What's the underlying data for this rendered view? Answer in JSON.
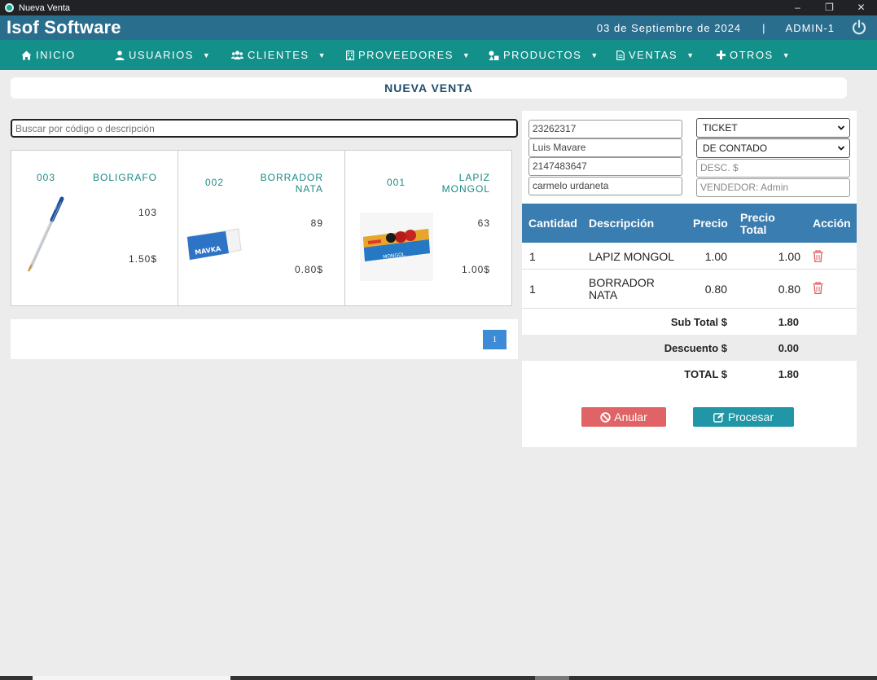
{
  "window": {
    "title": "Nueva Venta",
    "controls": [
      "–",
      "❐",
      "✕"
    ]
  },
  "header": {
    "brand": "Isof Software",
    "date": "03 de Septiembre de 2024",
    "separator": "|",
    "user": "ADMIN-1"
  },
  "nav": [
    {
      "label": "INICIO",
      "icon": "home-icon"
    },
    {
      "label": "USUARIOS",
      "icon": "user-icon"
    },
    {
      "label": "CLIENTES",
      "icon": "users-icon"
    },
    {
      "label": "PROVEEDORES",
      "icon": "building-icon"
    },
    {
      "label": "PRODUCTOS",
      "icon": "shapes-icon"
    },
    {
      "label": "VENTAS",
      "icon": "document-icon"
    },
    {
      "label": "OTROS",
      "icon": "plus-icon"
    }
  ],
  "caret": "▼",
  "page_title": "NUEVA VENTA",
  "search": {
    "placeholder": "Buscar por código o descripción",
    "value": ""
  },
  "products": [
    {
      "code": "003",
      "description": "BOLIGRAFO",
      "stock": "103",
      "price": "1.50$",
      "image": "pen-image"
    },
    {
      "code": "002",
      "description": "BORRADOR NATA",
      "stock": "89",
      "price": "0.80$",
      "image": "eraser-image"
    },
    {
      "code": "001",
      "description": "LAPIZ MONGOL",
      "stock": "63",
      "price": "1.00$",
      "image": "pencil-box-image"
    }
  ],
  "pagination": {
    "current": "1"
  },
  "customer": {
    "id": "23262317",
    "name": "Luis Mavare",
    "phone": "2147483647",
    "address": "carmelo urdaneta",
    "document_type": "TICKET",
    "payment_type": "DE CONTADO",
    "discount_placeholder": "DESC. $",
    "seller": "VENDEDOR: Admin"
  },
  "table": {
    "headers": {
      "qty": "Cantidad",
      "desc": "Descripción",
      "price": "Precio",
      "total_line1": "Precio",
      "total_line2": "Total",
      "action": "Acción"
    },
    "rows": [
      {
        "qty": "1",
        "desc1": "LAPIZ MONGOL",
        "desc2": "",
        "price": "1.00",
        "total": "1.00"
      },
      {
        "qty": "1",
        "desc1": "BORRADOR",
        "desc2": "NATA",
        "price": "0.80",
        "total": "0.80"
      }
    ]
  },
  "totals": {
    "subtotal_label": "Sub Total $",
    "subtotal": "1.80",
    "discount_label": "Descuento $",
    "discount": "0.00",
    "total_label": "TOTAL $",
    "total": "1.80"
  },
  "buttons": {
    "cancel": "Anular",
    "process": "Procesar"
  },
  "colors": {
    "header": "#2a6e8e",
    "nav": "#13908a",
    "table_header": "#3a7db0",
    "cancel": "#e06466",
    "process": "#2196a6",
    "trash": "#e05a5a"
  }
}
